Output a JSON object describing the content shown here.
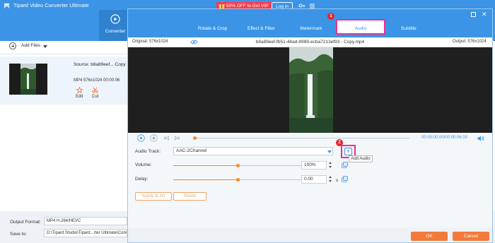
{
  "app": {
    "title": "Tipard Video Converter Ultimate",
    "promo": "50% OFF to Get VIP",
    "login": "Log in",
    "converter_tab": "Converter",
    "add_files": "Add Files"
  },
  "file": {
    "source": "Source: b8a89eef... Copy",
    "format_line": "MP4    576x1024    00:00:06",
    "edit_label": "Edit",
    "cut_label": "Cut"
  },
  "bottom": {
    "output_format_label": "Output Format:",
    "output_format_value": "MP4 H.264/HEVC",
    "save_to_label": "Save to:",
    "save_to_value": "D:\\Tipard Studio\\Tipard...rter Ultimate\\Converted"
  },
  "dialog": {
    "tabs": [
      "Rotate & Crop",
      "Effect & Filter",
      "Watermark",
      "Audio",
      "Subtitle"
    ],
    "active_tab": "Audio",
    "original": "Original: 576x1024",
    "filename": "b8a89eef-fb51-46ad-8989-ecba7213ef93 - Copy.mp4",
    "output": "Output: 576x1024",
    "time": "00:00:00.00/00:00:06.00",
    "playback_position": 0.0,
    "audio_track_label": "Audio Track:",
    "audio_track_value": "AAC-2Channel",
    "add_audio_tooltip": "Add Audio",
    "volume_label": "Volume:",
    "volume_value": "100%",
    "volume_level": 0.5,
    "delay_label": "Delay:",
    "delay_value": "0.00",
    "delay_unit": "s",
    "delay_level": 0.5,
    "apply_all": "Apply to All",
    "reset": "Reset",
    "ok": "OK",
    "cancel": "Cancel"
  },
  "annotations": [
    "1",
    "2"
  ],
  "colors": {
    "brand_blue": "#3b94e6",
    "accent_orange": "#f37a3a",
    "highlight_pink": "#e8328e",
    "badge_red": "#e8252d"
  }
}
